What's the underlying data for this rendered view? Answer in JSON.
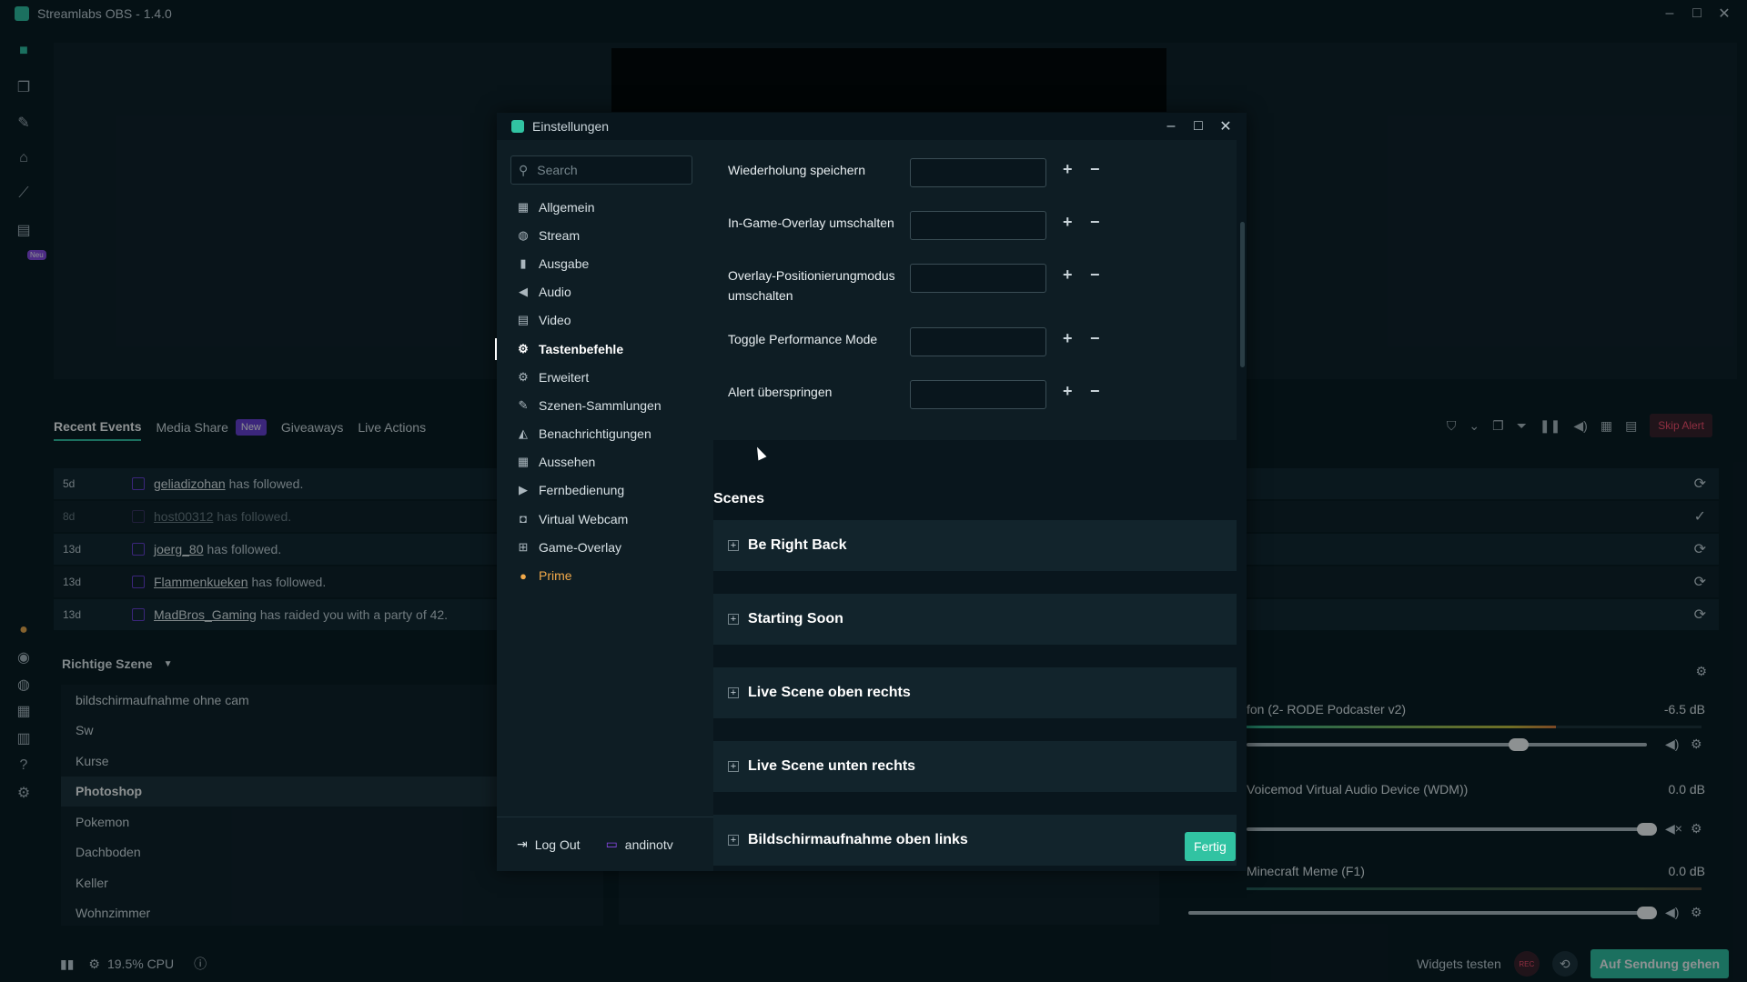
{
  "window": {
    "title": "Streamlabs OBS - 1.4.0",
    "controls": [
      "–",
      "□",
      "✕"
    ]
  },
  "rail": {
    "items": [
      "studio-icon",
      "themes-icon",
      "tools-icon",
      "store-icon",
      "stats-icon",
      "alertbox-icon",
      "prime-icon",
      "media-icon",
      "discord-icon",
      "layout-icon",
      "studio-mode-icon",
      "help-icon",
      "settings-icon"
    ],
    "neu_badge": "Neu"
  },
  "events": {
    "tabs": [
      {
        "label": "Recent Events"
      },
      {
        "label": "Media Share"
      },
      {
        "label": "Giveaways"
      },
      {
        "label": "Live Actions"
      }
    ],
    "new_badge": "New",
    "skip_alert": "Skip Alert",
    "rows": [
      {
        "age": "5d",
        "name": "geliadizohan",
        "action": "has followed."
      },
      {
        "age": "8d",
        "name": "host00312",
        "action": "has followed."
      },
      {
        "age": "13d",
        "name": "joerg_80",
        "action": "has followed."
      },
      {
        "age": "13d",
        "name": "Flammenkueken",
        "action": "has followed."
      },
      {
        "age": "13d",
        "name": "MadBros_Gaming",
        "action": "has raided you with a party of 42."
      }
    ]
  },
  "scenes_panel": {
    "title": "Richtige Szene",
    "items": [
      "bildschirmaufnahme ohne cam",
      "Sw",
      "Kurse",
      "Photoshop",
      "Pokemon",
      "Dachboden",
      "Keller",
      "Wohnzimmer"
    ],
    "selected": "Photoshop"
  },
  "mixer": {
    "rows": [
      {
        "name": "fon (2- RODE Podcaster v2)",
        "db": "-6.5 dB",
        "level": 0.68
      },
      {
        "name": "Voicemod Virtual Audio Device (WDM))",
        "db": "0.0 dB",
        "level": 1.0
      },
      {
        "name": "Minecraft Meme (F1)",
        "db": "0.0 dB",
        "level": 1.0
      }
    ]
  },
  "statusbar": {
    "cpu": "19.5% CPU",
    "widgets_test": "Widgets testen",
    "rec": "REC",
    "go_live": "Auf Sendung gehen"
  },
  "settings": {
    "title": "Einstellungen",
    "search_placeholder": "Search",
    "nav": [
      {
        "label": "Allgemein",
        "icon": "grid-icon"
      },
      {
        "label": "Stream",
        "icon": "globe-icon"
      },
      {
        "label": "Ausgabe",
        "icon": "output-icon"
      },
      {
        "label": "Audio",
        "icon": "speaker-icon"
      },
      {
        "label": "Video",
        "icon": "film-icon"
      },
      {
        "label": "Tastenbefehle",
        "icon": "gear-icon"
      },
      {
        "label": "Erweitert",
        "icon": "cogs-icon"
      },
      {
        "label": "Szenen-Sammlungen",
        "icon": "tools-icon"
      },
      {
        "label": "Benachrichtigungen",
        "icon": "bell-icon"
      },
      {
        "label": "Aussehen",
        "icon": "layout-icon"
      },
      {
        "label": "Fernbedienung",
        "icon": "remote-icon"
      },
      {
        "label": "Virtual Webcam",
        "icon": "camera-icon"
      },
      {
        "label": "Game-Overlay",
        "icon": "overlay-icon"
      },
      {
        "label": "Prime",
        "icon": "prime-icon"
      }
    ],
    "active_nav": "Tastenbefehle",
    "logout": "Log Out",
    "username": "andinotv",
    "hotkeys": [
      {
        "label": "Wiederholung speichern",
        "value": ""
      },
      {
        "label": "In-Game-Overlay umschalten",
        "value": ""
      },
      {
        "label": "Overlay-Positionierungmodus umschalten",
        "value": ""
      },
      {
        "label": "Toggle Performance Mode",
        "value": ""
      },
      {
        "label": "Alert überspringen",
        "value": ""
      }
    ],
    "scenes_title": "Scenes",
    "scenes": [
      "Be Right Back",
      "Starting Soon",
      "Live Scene oben rechts",
      "Live Scene unten rechts",
      "Bildschirmaufnahme oben links"
    ],
    "done": "Fertig"
  },
  "colors": {
    "accent": "#31c3a2",
    "background": "#09161d",
    "panel": "#0e1d24",
    "prime": "#f1a94a",
    "danger": "#ff4b6a",
    "twitch": "#6b3cd6"
  }
}
